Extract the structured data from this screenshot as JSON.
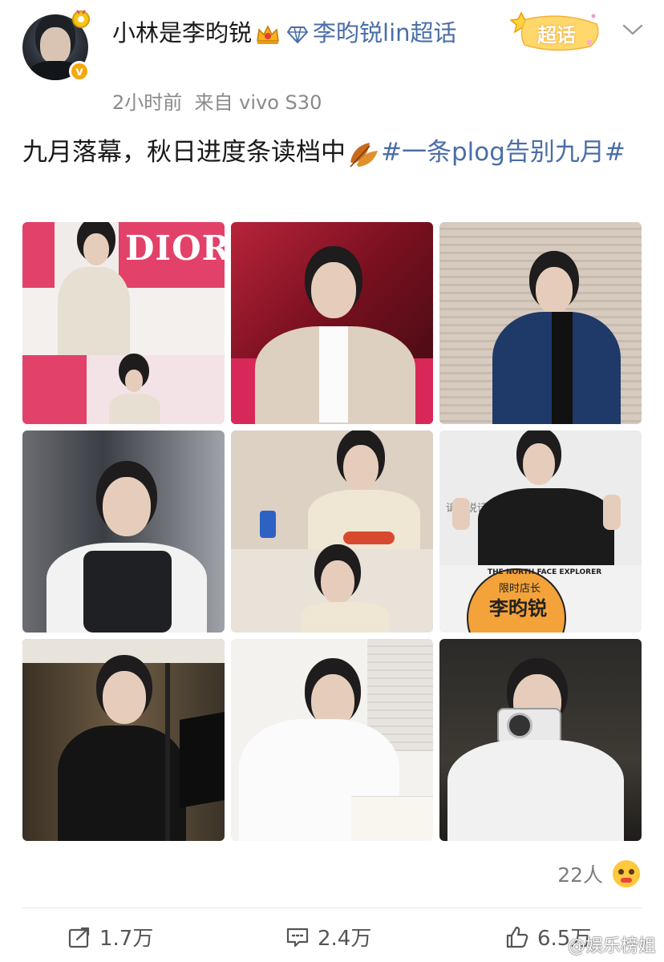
{
  "post": {
    "username": "小林是李昀锐",
    "supertopic": "李昀锐lin超话",
    "time": "2小时前",
    "source": "来自 vivo S30",
    "chaohua_label": "超话",
    "text_main": "九月落幕，秋日进度条读档中",
    "hashtag": "#一条plog告别九月#"
  },
  "photos": [
    {
      "label": "DIOR"
    },
    {
      "label": ""
    },
    {
      "label": ""
    },
    {
      "label": ""
    },
    {
      "label": ""
    },
    {
      "label": "限时店长 李昀锐"
    },
    {
      "label": ""
    },
    {
      "label": ""
    },
    {
      "label": ""
    }
  ],
  "photo_text": {
    "dior": "DIOR",
    "dior_small": "DIOR",
    "north_face": "THE NORTH FACE EXPLORER",
    "store_title": "限时店长",
    "store_name": "李昀锐",
    "sign": "请…说话"
  },
  "footer": {
    "likers_count": "22人",
    "repost": "1.7万",
    "comment": "2.4万",
    "like": "6.5万",
    "watermark": "@娱乐榜姐"
  },
  "colors": {
    "link": "#4a6ea8",
    "meta": "#8a8a8a",
    "verify": "#f7a70a"
  },
  "icons": [
    "verified-badge-icon",
    "crown-icon",
    "diamond-icon",
    "chaohua-icon",
    "chevron-down-icon",
    "leaf-icon",
    "repost-icon",
    "comment-icon",
    "like-icon",
    "emoji-icon"
  ]
}
